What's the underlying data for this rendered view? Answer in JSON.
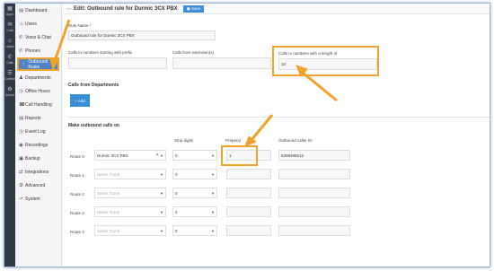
{
  "iconbar": {
    "items": [
      {
        "icon": "grid-icon",
        "glyph": "▦",
        "label": "Apps"
      },
      {
        "icon": "chat-icon",
        "glyph": "✉",
        "label": "Chat"
      },
      {
        "icon": "people-icon",
        "glyph": "☺",
        "label": "Users"
      },
      {
        "icon": "phone-icon",
        "glyph": "✆",
        "label": "Calls"
      },
      {
        "icon": "book-icon",
        "glyph": "☰",
        "label": "Contacts"
      },
      {
        "icon": "gear-icon",
        "glyph": "⚙",
        "label": "Admin"
      }
    ]
  },
  "sidebar": {
    "items": [
      {
        "glyph": "▤",
        "label": "Dashboard"
      },
      {
        "glyph": "☺",
        "label": "Users"
      },
      {
        "glyph": "✆",
        "label": "Voice & Chat"
      },
      {
        "glyph": "✆",
        "label": "Phones"
      },
      {
        "glyph": "↑",
        "label": "Outbound Rules"
      },
      {
        "glyph": "♟",
        "label": "Departments"
      },
      {
        "glyph": "◷",
        "label": "Office Hours"
      },
      {
        "glyph": "☎",
        "label": "Call Handling"
      },
      {
        "glyph": "▤",
        "label": "Reports"
      },
      {
        "glyph": "◷",
        "label": "Event Log"
      },
      {
        "glyph": "◉",
        "label": "Recordings"
      },
      {
        "glyph": "▣",
        "label": "Backup"
      },
      {
        "glyph": "⇄",
        "label": "Integrations"
      },
      {
        "glyph": "⚙",
        "label": "Advanced"
      },
      {
        "glyph": "⬏",
        "label": "System"
      }
    ]
  },
  "header": {
    "title": "Edit: Outbound rule for Durmic 3CX PBX",
    "save_label": "Save",
    "save_glyph": "▣"
  },
  "form": {
    "rule_name_label": "Rule Name *",
    "rule_name_value": "Outbound rule for Durmic 3CX PBX",
    "prefix_label": "Calls to numbers starting with prefix",
    "prefix_value": "",
    "extension_label": "Calls from extension(s)",
    "extension_value": "",
    "length_label": "Calls to numbers with a length of",
    "length_value": "10",
    "departments_heading": "Calls from Departments",
    "add_label": "+ Add",
    "outbound_heading": "Make outbound calls on",
    "col_strip": "Strip digits",
    "col_prepend": "Prepend",
    "col_callerid": "Outbound caller ID",
    "routes": [
      {
        "label": "Route 0",
        "trunk": "Durmic 3CX PBX",
        "strip": "0",
        "prepend": "1",
        "callerid": "6309489212"
      },
      {
        "label": "Route 1",
        "trunk": "Select Trunk",
        "strip": "0",
        "prepend": "",
        "callerid": ""
      },
      {
        "label": "Route 2",
        "trunk": "Select Trunk",
        "strip": "0",
        "prepend": "",
        "callerid": ""
      },
      {
        "label": "Route 3",
        "trunk": "Select Trunk",
        "strip": "0",
        "prepend": "",
        "callerid": ""
      },
      {
        "label": "Route 4",
        "trunk": "Select Trunk",
        "strip": "0",
        "prepend": "",
        "callerid": ""
      }
    ]
  },
  "colors": {
    "accent": "#3a8ed8",
    "highlight": "#f2a12a",
    "active_nav": "#4f84c4",
    "iconbar": "#2f3a48"
  }
}
